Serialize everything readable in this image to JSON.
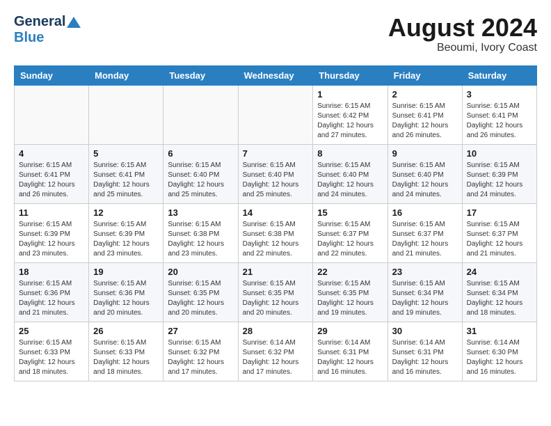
{
  "header": {
    "logo_general": "General",
    "logo_blue": "Blue",
    "month": "August 2024",
    "location": "Beoumi, Ivory Coast"
  },
  "weekdays": [
    "Sunday",
    "Monday",
    "Tuesday",
    "Wednesday",
    "Thursday",
    "Friday",
    "Saturday"
  ],
  "weeks": [
    [
      {
        "day": "",
        "info": ""
      },
      {
        "day": "",
        "info": ""
      },
      {
        "day": "",
        "info": ""
      },
      {
        "day": "",
        "info": ""
      },
      {
        "day": "1",
        "info": "Sunrise: 6:15 AM\nSunset: 6:42 PM\nDaylight: 12 hours\nand 27 minutes."
      },
      {
        "day": "2",
        "info": "Sunrise: 6:15 AM\nSunset: 6:41 PM\nDaylight: 12 hours\nand 26 minutes."
      },
      {
        "day": "3",
        "info": "Sunrise: 6:15 AM\nSunset: 6:41 PM\nDaylight: 12 hours\nand 26 minutes."
      }
    ],
    [
      {
        "day": "4",
        "info": "Sunrise: 6:15 AM\nSunset: 6:41 PM\nDaylight: 12 hours\nand 26 minutes."
      },
      {
        "day": "5",
        "info": "Sunrise: 6:15 AM\nSunset: 6:41 PM\nDaylight: 12 hours\nand 25 minutes."
      },
      {
        "day": "6",
        "info": "Sunrise: 6:15 AM\nSunset: 6:40 PM\nDaylight: 12 hours\nand 25 minutes."
      },
      {
        "day": "7",
        "info": "Sunrise: 6:15 AM\nSunset: 6:40 PM\nDaylight: 12 hours\nand 25 minutes."
      },
      {
        "day": "8",
        "info": "Sunrise: 6:15 AM\nSunset: 6:40 PM\nDaylight: 12 hours\nand 24 minutes."
      },
      {
        "day": "9",
        "info": "Sunrise: 6:15 AM\nSunset: 6:40 PM\nDaylight: 12 hours\nand 24 minutes."
      },
      {
        "day": "10",
        "info": "Sunrise: 6:15 AM\nSunset: 6:39 PM\nDaylight: 12 hours\nand 24 minutes."
      }
    ],
    [
      {
        "day": "11",
        "info": "Sunrise: 6:15 AM\nSunset: 6:39 PM\nDaylight: 12 hours\nand 23 minutes."
      },
      {
        "day": "12",
        "info": "Sunrise: 6:15 AM\nSunset: 6:39 PM\nDaylight: 12 hours\nand 23 minutes."
      },
      {
        "day": "13",
        "info": "Sunrise: 6:15 AM\nSunset: 6:38 PM\nDaylight: 12 hours\nand 23 minutes."
      },
      {
        "day": "14",
        "info": "Sunrise: 6:15 AM\nSunset: 6:38 PM\nDaylight: 12 hours\nand 22 minutes."
      },
      {
        "day": "15",
        "info": "Sunrise: 6:15 AM\nSunset: 6:37 PM\nDaylight: 12 hours\nand 22 minutes."
      },
      {
        "day": "16",
        "info": "Sunrise: 6:15 AM\nSunset: 6:37 PM\nDaylight: 12 hours\nand 21 minutes."
      },
      {
        "day": "17",
        "info": "Sunrise: 6:15 AM\nSunset: 6:37 PM\nDaylight: 12 hours\nand 21 minutes."
      }
    ],
    [
      {
        "day": "18",
        "info": "Sunrise: 6:15 AM\nSunset: 6:36 PM\nDaylight: 12 hours\nand 21 minutes."
      },
      {
        "day": "19",
        "info": "Sunrise: 6:15 AM\nSunset: 6:36 PM\nDaylight: 12 hours\nand 20 minutes."
      },
      {
        "day": "20",
        "info": "Sunrise: 6:15 AM\nSunset: 6:35 PM\nDaylight: 12 hours\nand 20 minutes."
      },
      {
        "day": "21",
        "info": "Sunrise: 6:15 AM\nSunset: 6:35 PM\nDaylight: 12 hours\nand 20 minutes."
      },
      {
        "day": "22",
        "info": "Sunrise: 6:15 AM\nSunset: 6:35 PM\nDaylight: 12 hours\nand 19 minutes."
      },
      {
        "day": "23",
        "info": "Sunrise: 6:15 AM\nSunset: 6:34 PM\nDaylight: 12 hours\nand 19 minutes."
      },
      {
        "day": "24",
        "info": "Sunrise: 6:15 AM\nSunset: 6:34 PM\nDaylight: 12 hours\nand 18 minutes."
      }
    ],
    [
      {
        "day": "25",
        "info": "Sunrise: 6:15 AM\nSunset: 6:33 PM\nDaylight: 12 hours\nand 18 minutes."
      },
      {
        "day": "26",
        "info": "Sunrise: 6:15 AM\nSunset: 6:33 PM\nDaylight: 12 hours\nand 18 minutes."
      },
      {
        "day": "27",
        "info": "Sunrise: 6:15 AM\nSunset: 6:32 PM\nDaylight: 12 hours\nand 17 minutes."
      },
      {
        "day": "28",
        "info": "Sunrise: 6:14 AM\nSunset: 6:32 PM\nDaylight: 12 hours\nand 17 minutes."
      },
      {
        "day": "29",
        "info": "Sunrise: 6:14 AM\nSunset: 6:31 PM\nDaylight: 12 hours\nand 16 minutes."
      },
      {
        "day": "30",
        "info": "Sunrise: 6:14 AM\nSunset: 6:31 PM\nDaylight: 12 hours\nand 16 minutes."
      },
      {
        "day": "31",
        "info": "Sunrise: 6:14 AM\nSunset: 6:30 PM\nDaylight: 12 hours\nand 16 minutes."
      }
    ]
  ]
}
